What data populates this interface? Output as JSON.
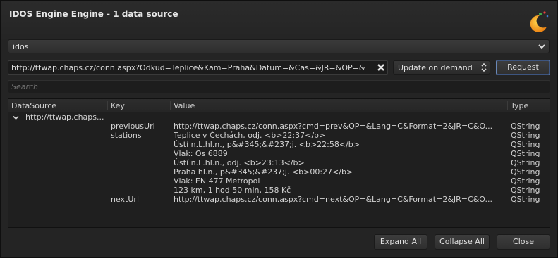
{
  "window": {
    "title": "IDOS Engine Engine - 1 data source"
  },
  "engine_selector": {
    "value": "idos"
  },
  "source_field": {
    "value": "http://ttwap.chaps.cz/conn.aspx?Odkud=Teplice&Kam=Praha&Datum=&Cas=&JR=&OP=&"
  },
  "update_mode": {
    "value": "Update on demand"
  },
  "request_button": {
    "label": "Request"
  },
  "search": {
    "placeholder": "Search"
  },
  "tree": {
    "columns": [
      "DataSource",
      "Key",
      "Value",
      "Type"
    ],
    "source": "http://ttwap.chaps...",
    "rows": [
      {
        "key": "previousUrl",
        "value": "http://ttwap.chaps.cz/conn.aspx?cmd=prev&OP=&Lang=C&Format=2&JR=C&O...",
        "type": "QString"
      },
      {
        "key": "stations",
        "value": "Teplice v Čechách, odj. <b>22:37</b>",
        "type": "QString"
      },
      {
        "key": "",
        "value": "Ústí n.L.hl.n., p&#345;&#237;j. <b>22:58</b>",
        "type": "QString"
      },
      {
        "key": "",
        "value": "Vlak: Os 6889",
        "type": "QString"
      },
      {
        "key": "",
        "value": "Ústí n.L.hl.n., odj. <b>23:13</b>",
        "type": "QString"
      },
      {
        "key": "",
        "value": "Praha hl.n., p&#345;&#237;j. <b>00:27</b>",
        "type": "QString"
      },
      {
        "key": "",
        "value": "Vlak: EN 477 Metropol",
        "type": "QString"
      },
      {
        "key": "",
        "value": "123 km, 1 hod 50 min, 158 Kč",
        "type": "QString"
      },
      {
        "key": "nextUrl",
        "value": "http://ttwap.chaps.cz/conn.aspx?cmd=next&OP=&Lang=C&Format=2&JR=C&O...",
        "type": "QString"
      }
    ]
  },
  "footer": {
    "expand_all": "Expand All",
    "collapse_all": "Collapse All",
    "close": "Close"
  },
  "icons": {
    "logo": "plasma-moon-logo-icon",
    "dropdown": "chevron-down-icon",
    "clear": "clear-text-icon",
    "spin": "up-down-arrows-icon",
    "expander": "tree-expand-chevron-icon"
  },
  "colors": {
    "accent": "#6a88b8",
    "logo_orange": "#f39c12"
  }
}
